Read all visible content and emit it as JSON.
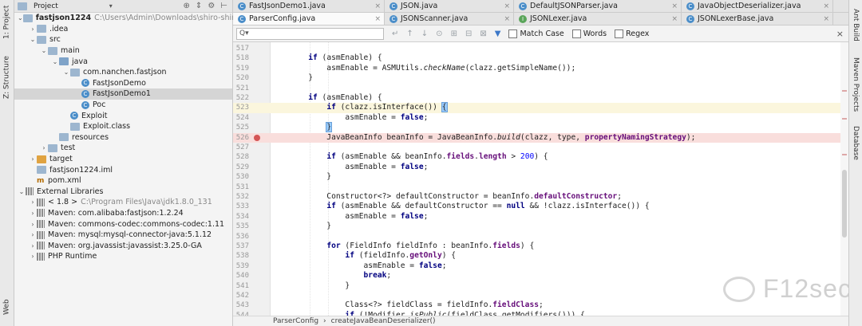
{
  "left_strip": {
    "project_tab": "1: Project",
    "structure_tab": "Z: Structure",
    "web_tab": "Web"
  },
  "right_strip": {
    "ant_tab": "Ant Build",
    "maven_tab": "Maven Projects",
    "database_tab": "Database"
  },
  "project_panel": {
    "title": "Project",
    "tree": [
      {
        "level": 0,
        "expanded": true,
        "icon": "module-folder",
        "label": "fastjson1224",
        "detail": "C:\\Users\\Admin\\Downloads\\shiro-shiro-root-1.2.4"
      },
      {
        "level": 1,
        "expanded": false,
        "icon": "folder",
        "label": ".idea"
      },
      {
        "level": 1,
        "expanded": true,
        "icon": "folder",
        "label": "src"
      },
      {
        "level": 2,
        "expanded": true,
        "icon": "folder",
        "label": "main"
      },
      {
        "level": 3,
        "expanded": true,
        "icon": "source-folder",
        "label": "java"
      },
      {
        "level": 4,
        "expanded": true,
        "icon": "package",
        "label": "com.nanchen.fastjson"
      },
      {
        "level": 5,
        "icon": "class",
        "label": "FastJsonDemo"
      },
      {
        "level": 5,
        "icon": "class",
        "label": "FastJsonDemo1",
        "selected": true
      },
      {
        "level": 5,
        "icon": "class",
        "label": "Poc"
      },
      {
        "level": 4,
        "icon": "class",
        "label": "Exploit"
      },
      {
        "level": 4,
        "icon": "class-file",
        "label": "Exploit.class"
      },
      {
        "level": 3,
        "icon": "folder",
        "label": "resources"
      },
      {
        "level": 2,
        "expanded": false,
        "icon": "folder",
        "label": "test"
      },
      {
        "level": 1,
        "expanded": false,
        "icon": "folder-excluded",
        "label": "target"
      },
      {
        "level": 1,
        "icon": "iml-file",
        "label": "fastjson1224.iml"
      },
      {
        "level": 1,
        "icon": "maven-file",
        "label": "pom.xml"
      },
      {
        "level": 0,
        "expanded": true,
        "icon": "libraries",
        "label": "External Libraries"
      },
      {
        "level": 1,
        "expanded": false,
        "icon": "jdk",
        "label": "< 1.8 >",
        "detail": "C:\\Program Files\\Java\\jdk1.8.0_131"
      },
      {
        "level": 1,
        "expanded": false,
        "icon": "library",
        "label": "Maven: com.alibaba:fastjson:1.2.24"
      },
      {
        "level": 1,
        "expanded": false,
        "icon": "library",
        "label": "Maven: commons-codec:commons-codec:1.11"
      },
      {
        "level": 1,
        "expanded": false,
        "icon": "library",
        "label": "Maven: mysql:mysql-connector-java:5.1.12"
      },
      {
        "level": 1,
        "expanded": false,
        "icon": "library",
        "label": "Maven: org.javassist:javassist:3.25.0-GA"
      },
      {
        "level": 1,
        "expanded": false,
        "icon": "library",
        "label": "PHP Runtime"
      }
    ]
  },
  "tabs_row1": [
    {
      "label": "FastJsonDemo1.java",
      "icon": "C",
      "close": "×"
    },
    {
      "label": "JSON.java",
      "icon": "C",
      "close": "×"
    },
    {
      "label": "DefaultJSONParser.java",
      "icon": "C",
      "close": "×"
    },
    {
      "label": "JavaObjectDeserializer.java",
      "icon": "C",
      "close": "×"
    }
  ],
  "tabs_row2": [
    {
      "label": "ParserConfig.java",
      "icon": "C",
      "close": "×",
      "active": true
    },
    {
      "label": "JSONScanner.java",
      "icon": "C",
      "close": "×"
    },
    {
      "label": "JSONLexer.java",
      "icon": "I",
      "close": "×"
    },
    {
      "label": "JSONLexerBase.java",
      "icon": "C",
      "close": "×"
    }
  ],
  "search": {
    "placeholder": "Q▾",
    "match_case": "Match Case",
    "words": "Words",
    "regex": "Regex",
    "close": "×"
  },
  "code_lines": [
    {
      "n": "517",
      "html": ""
    },
    {
      "n": "518",
      "html": "        <span class=\"kw\">if</span> (asmEnable) {"
    },
    {
      "n": "519",
      "html": "            asmEnable = ASMUtils.<span class=\"it\">checkName</span>(clazz.getSimpleName());"
    },
    {
      "n": "520",
      "html": "        }"
    },
    {
      "n": "521",
      "html": ""
    },
    {
      "n": "522",
      "html": "        <span class=\"kw\">if</span> (asmEnable) {"
    },
    {
      "n": "523",
      "html": "            <span class=\"kw\">if</span> (clazz.isInterface()) <span class=\"brace\">{</span>",
      "cls": "cur"
    },
    {
      "n": "524",
      "html": "                asmEnable = <span class=\"kw\">false</span>;"
    },
    {
      "n": "525",
      "html": "            <span class=\"brace\">}</span>"
    },
    {
      "n": "526",
      "html": "            JavaBeanInfo beanInfo = JavaBeanInfo.<span class=\"it\">build</span>(clazz, type, <span class=\"fld\">propertyNamingStrategy</span>);",
      "cls": "bp"
    },
    {
      "n": "527",
      "html": ""
    },
    {
      "n": "528",
      "html": "            <span class=\"kw\">if</span> (asmEnable &amp;&amp; beanInfo.<span class=\"fld\">fields</span>.<span class=\"fld\">length</span> &gt; <span class=\"num\">200</span>) {"
    },
    {
      "n": "529",
      "html": "                asmEnable = <span class=\"kw\">false</span>;"
    },
    {
      "n": "530",
      "html": "            }"
    },
    {
      "n": "531",
      "html": ""
    },
    {
      "n": "532",
      "html": "            Constructor&lt;?&gt; defaultConstructor = beanInfo.<span class=\"fld\">defaultConstructor</span>;"
    },
    {
      "n": "533",
      "html": "            <span class=\"kw\">if</span> (asmEnable &amp;&amp; defaultConstructor == <span class=\"kw\">null</span> &amp;&amp; !clazz.isInterface()) {"
    },
    {
      "n": "534",
      "html": "                asmEnable = <span class=\"kw\">false</span>;"
    },
    {
      "n": "535",
      "html": "            }"
    },
    {
      "n": "536",
      "html": ""
    },
    {
      "n": "537",
      "html": "            <span class=\"kw\">for</span> (FieldInfo fieldInfo : beanInfo.<span class=\"fld\">fields</span>) {"
    },
    {
      "n": "538",
      "html": "                <span class=\"kw\">if</span> (fieldInfo.<span class=\"fld\">getOnly</span>) {"
    },
    {
      "n": "539",
      "html": "                    asmEnable = <span class=\"kw\">false</span>;"
    },
    {
      "n": "540",
      "html": "                    <span class=\"kw\">break</span>;"
    },
    {
      "n": "541",
      "html": "                }"
    },
    {
      "n": "542",
      "html": ""
    },
    {
      "n": "543",
      "html": "                Class&lt;?&gt; fieldClass = fieldInfo.<span class=\"fld\">fieldClass</span>;"
    },
    {
      "n": "544",
      "html": "                <span class=\"kw\">if</span> (!Modifier.<span class=\"it\">isPublic</span>(fieldClass.getModifiers())) {"
    }
  ],
  "breadcrumbs": [
    "ParserConfig",
    "createJavaBeanDeserializer()"
  ],
  "watermark": "F12sec"
}
